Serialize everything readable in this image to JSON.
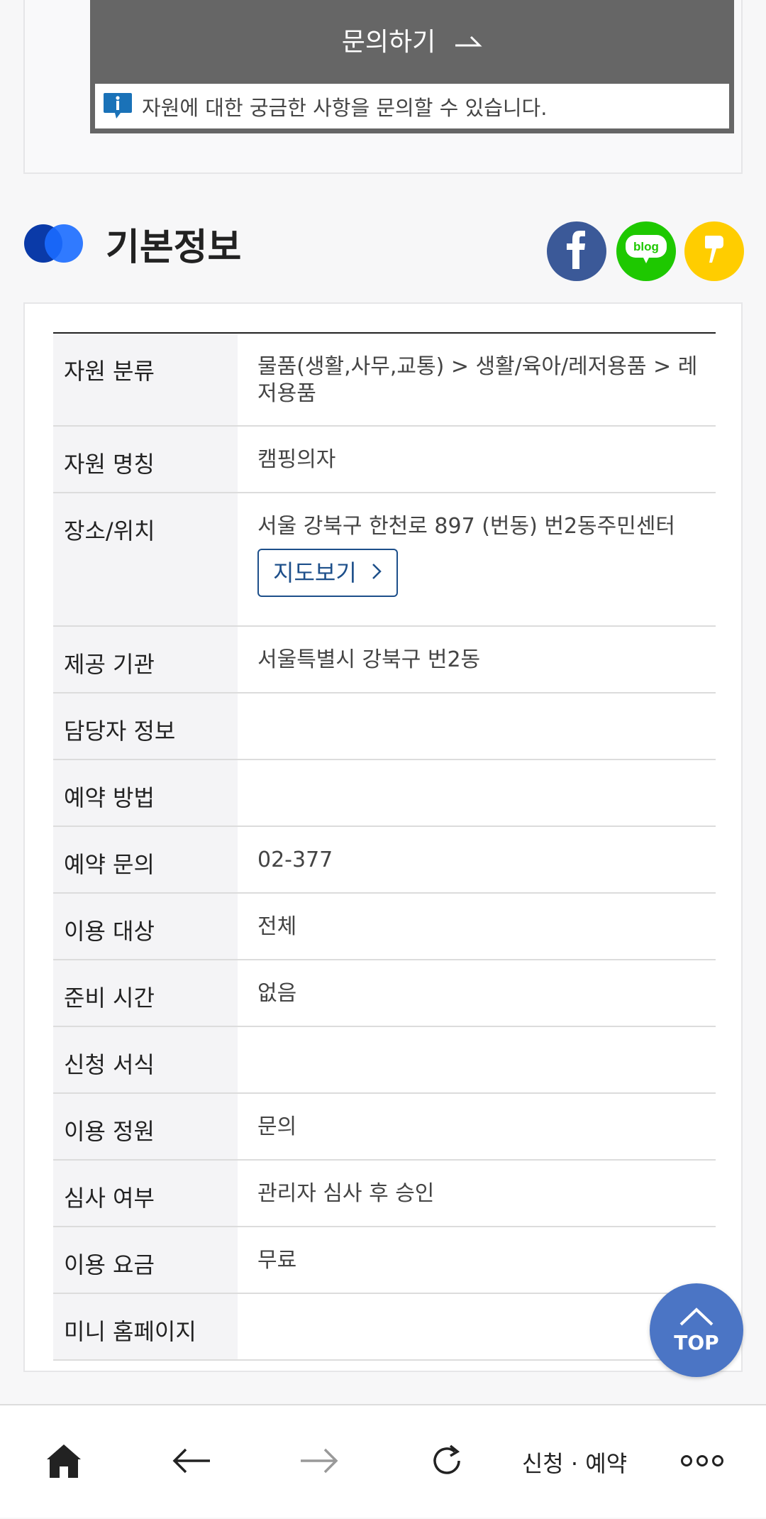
{
  "inquiry": {
    "button_label": "문의하기",
    "notice": "자원에 대한 궁금한 사항을 문의할 수 있습니다."
  },
  "section": {
    "title": "기본정보",
    "share_icons": [
      "facebook-icon",
      "blog-icon",
      "kakao-story-icon"
    ],
    "blog_label": "blog"
  },
  "info": {
    "rows": [
      {
        "label": "자원 분류",
        "value": "물품(생활,사무,교통) > 생활/육아/레저용품 > 레저용품"
      },
      {
        "label": "자원 명칭",
        "value": "캠핑의자"
      },
      {
        "label": "장소/위치",
        "value": "서울 강북구 한천로 897 (번동) 번2동주민센터"
      },
      {
        "label": "제공 기관",
        "value": "서울특별시 강북구 번2동"
      },
      {
        "label": "담당자 정보",
        "value": ""
      },
      {
        "label": "예약 방법",
        "value": ""
      },
      {
        "label": "예약 문의",
        "value": "02-377"
      },
      {
        "label": "이용 대상",
        "value": "전체"
      },
      {
        "label": "준비 시간",
        "value": "없음"
      },
      {
        "label": "신청 서식",
        "value": ""
      },
      {
        "label": "이용 정원",
        "value": "문의"
      },
      {
        "label": "심사 여부",
        "value": "관리자 심사 후 승인"
      },
      {
        "label": "이용 요금",
        "value": "무료"
      },
      {
        "label": "미니 홈페이지",
        "value": ""
      }
    ],
    "map_button": "지도보기"
  },
  "top_button": "TOP",
  "bottom_nav": {
    "icons": [
      "home-icon",
      "back-arrow-icon",
      "forward-arrow-icon",
      "refresh-icon",
      "more-icon"
    ],
    "reserve_label": "신청 · 예약"
  },
  "colors": {
    "inquiry_bg": "#666666",
    "accent_blue": "#1d4f8a",
    "top_button_bg": "#4b75c5",
    "facebook": "#3b5998",
    "blog": "#1ec800",
    "kakao": "#ffcd00"
  }
}
